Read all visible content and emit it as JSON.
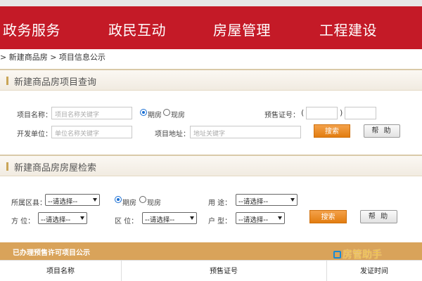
{
  "nav": [
    "政务服务",
    "政民互动",
    "房屋管理",
    "工程建设"
  ],
  "breadcrumb": "> 新建商品房 > 项目信息公示",
  "project_query": {
    "title": "新建商品房项目查询",
    "project_name_label": "项目名称：",
    "project_name_placeholder": "项目名称关键字",
    "radio_presale": "期房",
    "radio_existing": "现房",
    "presale_cert_label": "预售证号：",
    "paren_open": "(",
    "paren_close": ")",
    "developer_label": "开发单位：",
    "developer_placeholder": "单位名称关键字",
    "address_label": "项目地址：",
    "address_placeholder": "地址关键字",
    "search_button": "搜索",
    "help_button": "帮 助"
  },
  "house_search": {
    "title": "新建商品房房屋检索",
    "district_label": "所属区县：",
    "district_value": "--请选择--",
    "radio_presale": "期房",
    "radio_existing": "现房",
    "usage_label": "用 途：",
    "usage_value": "--请选择--",
    "orientation_label": "方 位：",
    "orientation_value": "--请选择--",
    "area_label": "区 位：",
    "area_value": "--请选择--",
    "layout_label": "户 型：",
    "layout_value": "--请选择--",
    "search_button": "搜索",
    "help_button": "帮 助"
  },
  "permit_table": {
    "title": "已办理预售许可项目公示",
    "columns": [
      "项目名称",
      "预售证号",
      "发证时间"
    ]
  },
  "watermark": "房管助手",
  "colors": {
    "nav_bg": "#c41a27",
    "accent_orange": "#e27d10",
    "table_head": "#d9a35a"
  }
}
